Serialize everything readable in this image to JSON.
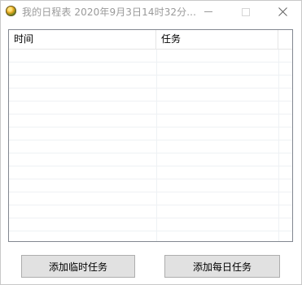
{
  "window": {
    "title": "我的日程表 2020年9月3日14时32分..."
  },
  "list": {
    "columns": [
      {
        "label": "时间"
      },
      {
        "label": "任务"
      }
    ],
    "rows": []
  },
  "buttons": {
    "add_temp_task": "添加临时任务",
    "add_daily_task": "添加每日任务"
  },
  "icons": {
    "app": "app-icon",
    "minimize": "minimize-icon",
    "maximize": "maximize-icon",
    "close": "close-icon"
  },
  "colors": {
    "title_text": "#9a9a9a",
    "button_face": "#e1e1e1",
    "button_border": "#adadad",
    "list_border": "#828790",
    "grid_line": "#eef1f4"
  }
}
